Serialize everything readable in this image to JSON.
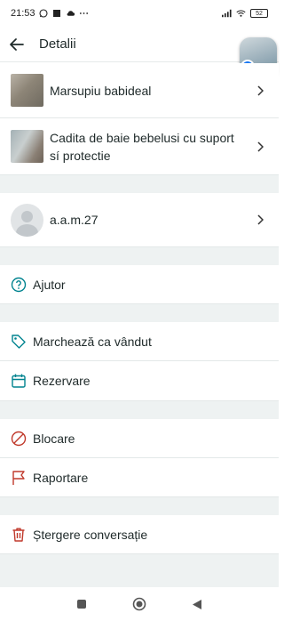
{
  "status_bar": {
    "time": "21:53",
    "battery": "52"
  },
  "header": {
    "title": "Detalii"
  },
  "items": [
    {
      "title": "Marsupiu babideal"
    },
    {
      "title": "Cadita de baie bebelusi cu suport sí protectie"
    }
  ],
  "user": {
    "name": "a.a.m.27"
  },
  "options": {
    "help": "Ajutor",
    "mark_sold": "Marchează ca vândut",
    "reserve": "Rezervare",
    "block": "Blocare",
    "report": "Raportare",
    "delete": "Ștergere conversație"
  },
  "colors": {
    "accent": "#00838f",
    "danger": "#c0392b",
    "divider": "#eef2f2"
  },
  "icons": {
    "help": "question-circle-icon",
    "mark_sold": "tag-icon",
    "reserve": "calendar-icon",
    "block": "block-icon",
    "report": "flag-icon",
    "delete": "trash-icon"
  }
}
